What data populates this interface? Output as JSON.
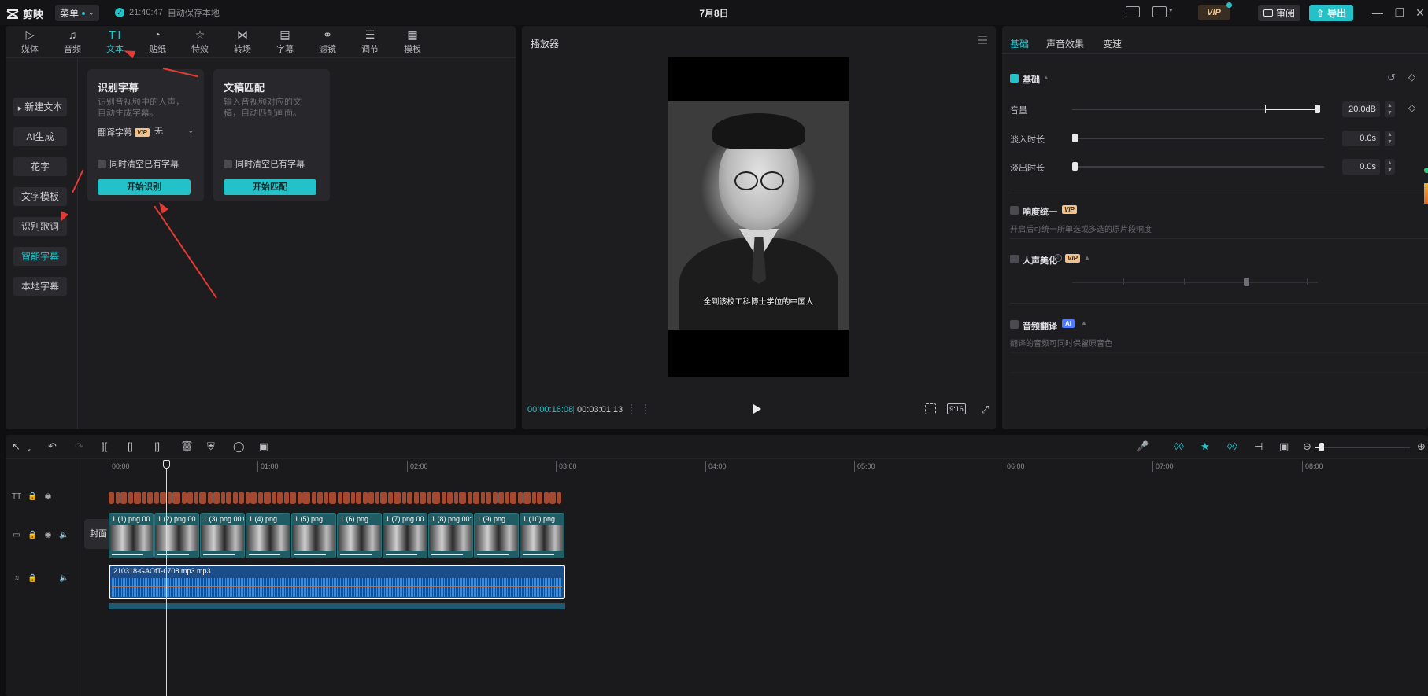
{
  "app": {
    "name": "剪映",
    "menu_label": "菜单",
    "save_time": "21:40:47",
    "save_status": "自动保存本地",
    "project_title": "7月8日",
    "vip_label": "VIP",
    "review_label": "审阅",
    "export_label": "导出"
  },
  "left_tabs": [
    {
      "label": "媒体",
      "icon": "media-icon"
    },
    {
      "label": "音频",
      "icon": "audio-icon"
    },
    {
      "label": "文本",
      "icon": "text-icon",
      "active": true
    },
    {
      "label": "贴纸",
      "icon": "sticker-icon"
    },
    {
      "label": "特效",
      "icon": "effects-icon"
    },
    {
      "label": "转场",
      "icon": "transition-icon"
    },
    {
      "label": "字幕",
      "icon": "subtitle-icon"
    },
    {
      "label": "滤镜",
      "icon": "filter-icon"
    },
    {
      "label": "调节",
      "icon": "adjust-icon"
    },
    {
      "label": "模板",
      "icon": "template-icon"
    }
  ],
  "left_side": [
    {
      "label": "新建文本",
      "expandable": true
    },
    {
      "label": "AI生成"
    },
    {
      "label": "花字"
    },
    {
      "label": "文字模板"
    },
    {
      "label": "识别歌词"
    },
    {
      "label": "智能字幕",
      "active": true
    },
    {
      "label": "本地字幕"
    }
  ],
  "card_recognize": {
    "title": "识别字幕",
    "desc": "识别音视频中的人声，自动生成字幕。",
    "translate_label": "翻译字幕",
    "translate_badge": "VIP",
    "translate_value": "无",
    "clear_label": "同时清空已有字幕",
    "cta": "开始识别"
  },
  "card_match": {
    "title": "文稿匹配",
    "desc": "输入音视频对应的文稿，自动匹配画面。",
    "clear_label": "同时清空已有字幕",
    "cta": "开始匹配"
  },
  "player": {
    "title": "播放器",
    "caption": "全到该校工科博士学位的中国人",
    "time_current": "00:00:16:08",
    "time_total": "00:03:01:13",
    "ratio": "9:16"
  },
  "props": {
    "tabs": [
      "基础",
      "声音效果",
      "变速"
    ],
    "basic": {
      "title": "基础",
      "rows": [
        {
          "label": "音量",
          "value": "20.0dB",
          "level": 0.96
        },
        {
          "label": "淡入时长",
          "value": "0.0s",
          "level": 0
        },
        {
          "label": "淡出时长",
          "value": "0.0s",
          "level": 0
        }
      ]
    },
    "loudness": {
      "title": "响度统一",
      "badge": "VIP",
      "hint": "开启后可统一所单选或多选的原片段响度"
    },
    "voice": {
      "title": "人声美化",
      "badge": "VIP",
      "level": 0.76
    },
    "translate": {
      "title": "音频翻译",
      "badge": "AI",
      "hint": "翻译的音频可同时保留原音色"
    }
  },
  "timeline": {
    "ruler": [
      "00:00",
      "01:00",
      "02:00",
      "03:00",
      "04:00",
      "05:00",
      "06:00",
      "07:00",
      "08:00"
    ],
    "cover_label": "封面",
    "clips": [
      {
        "name": "1 (1).png",
        "suffix": "00"
      },
      {
        "name": "1 (2).png",
        "suffix": "00"
      },
      {
        "name": "1 (3).png",
        "suffix": "00:0"
      },
      {
        "name": "1 (4).png",
        "suffix": ""
      },
      {
        "name": "1 (5).png",
        "suffix": ""
      },
      {
        "name": "1 (6).png",
        "suffix": ""
      },
      {
        "name": "1 (7).png",
        "suffix": "00"
      },
      {
        "name": "1 (8).png",
        "suffix": "00:0"
      },
      {
        "name": "1 (9).png",
        "suffix": ""
      },
      {
        "name": "1 (10).png",
        "suffix": ""
      }
    ],
    "audio_name": "210318-GAOfT-0708.mp3.mp3"
  },
  "colors": {
    "accent": "#23c2c9",
    "text_clip": "#a4492f",
    "video_clip": "#1f5c63",
    "audio_clip": "#1b4d8a",
    "annotation": "#e33a34"
  }
}
